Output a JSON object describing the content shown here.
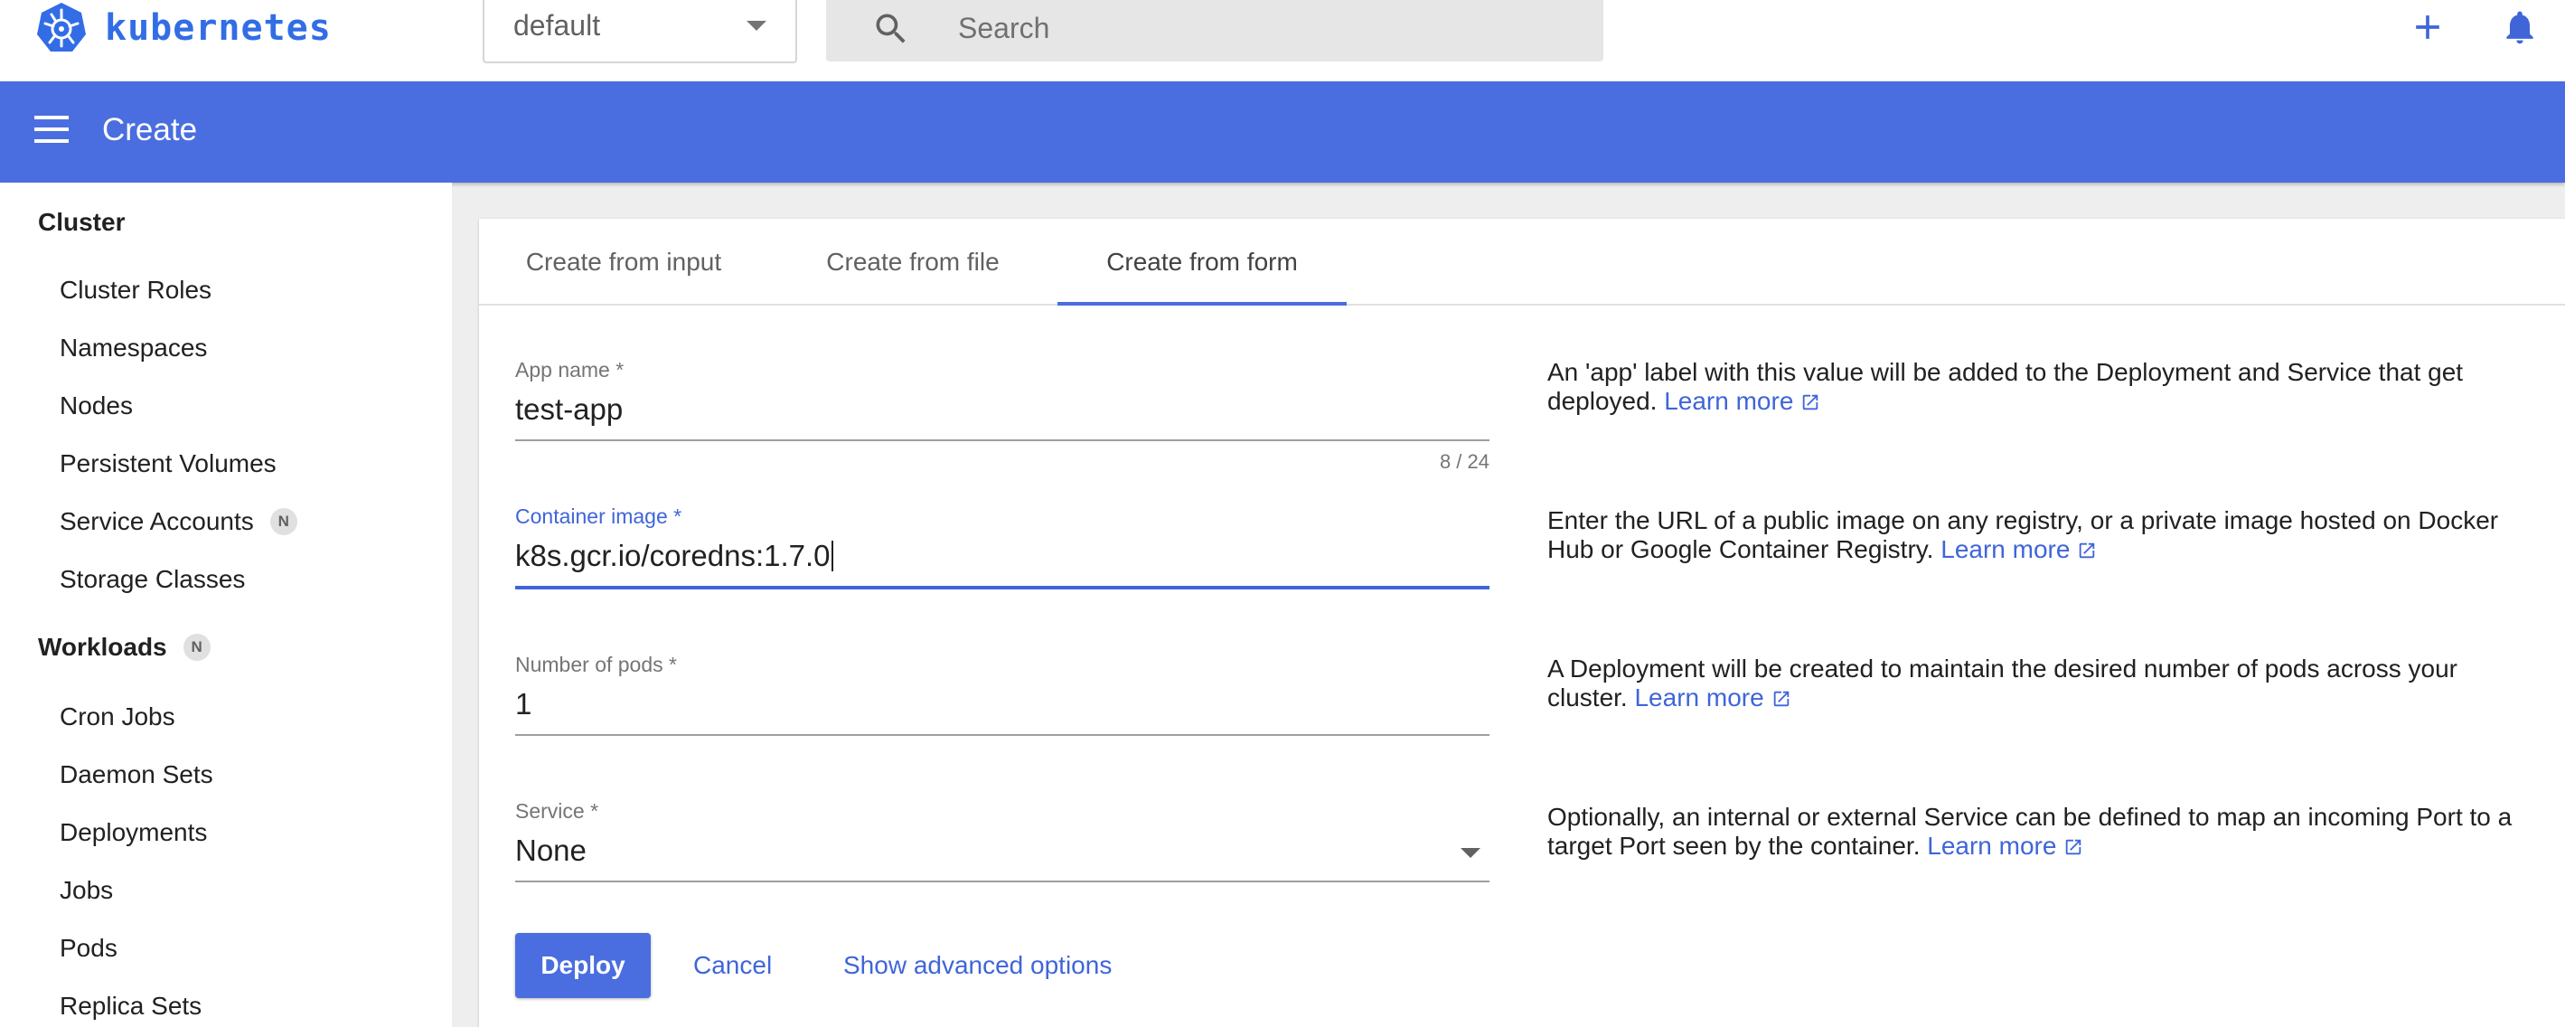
{
  "app": {
    "brand": "kubernetes",
    "brand_color": "#326de6",
    "accent_color": "#4a6ee0"
  },
  "topbar": {
    "namespace_selected": "default",
    "search_placeholder": "Search",
    "icons": [
      "kubernetes-logo",
      "chevron-down-icon",
      "search-icon",
      "plus-icon",
      "bell-icon"
    ]
  },
  "header": {
    "title": "Create"
  },
  "sidebar": {
    "sections": [
      {
        "title": "Cluster",
        "badge": "",
        "items": [
          {
            "label": "Cluster Roles",
            "badge": ""
          },
          {
            "label": "Namespaces",
            "badge": ""
          },
          {
            "label": "Nodes",
            "badge": ""
          },
          {
            "label": "Persistent Volumes",
            "badge": ""
          },
          {
            "label": "Service Accounts",
            "badge": "N"
          },
          {
            "label": "Storage Classes",
            "badge": ""
          }
        ]
      },
      {
        "title": "Workloads",
        "badge": "N",
        "items": [
          {
            "label": "Cron Jobs",
            "badge": ""
          },
          {
            "label": "Daemon Sets",
            "badge": ""
          },
          {
            "label": "Deployments",
            "badge": ""
          },
          {
            "label": "Jobs",
            "badge": ""
          },
          {
            "label": "Pods",
            "badge": ""
          },
          {
            "label": "Replica Sets",
            "badge": ""
          }
        ]
      }
    ]
  },
  "tabs": [
    {
      "label": "Create from input",
      "active": false
    },
    {
      "label": "Create from file",
      "active": false
    },
    {
      "label": "Create from form",
      "active": true
    }
  ],
  "form": {
    "app_name": {
      "label": "App name *",
      "value": "test-app",
      "counter": "8 / 24"
    },
    "container_image": {
      "label": "Container image *",
      "value": "k8s.gcr.io/coredns:1.7.0"
    },
    "pods": {
      "label": "Number of pods *",
      "value": "1"
    },
    "service": {
      "label": "Service *",
      "value": "None"
    }
  },
  "help": {
    "app_name": "An 'app' label with this value will be added to the Deployment and Service that get deployed.",
    "container_image": "Enter the URL of a public image on any registry, or a private image hosted on Docker Hub or Google Container Registry.",
    "pods": "A Deployment will be created to maintain the desired number of pods across your cluster.",
    "service": "Optionally, an internal or external Service can be defined to map an incoming Port to a target Port seen by the container.",
    "learn_more": "Learn more"
  },
  "actions": {
    "deploy": "Deploy",
    "cancel": "Cancel",
    "advanced": "Show advanced options"
  }
}
